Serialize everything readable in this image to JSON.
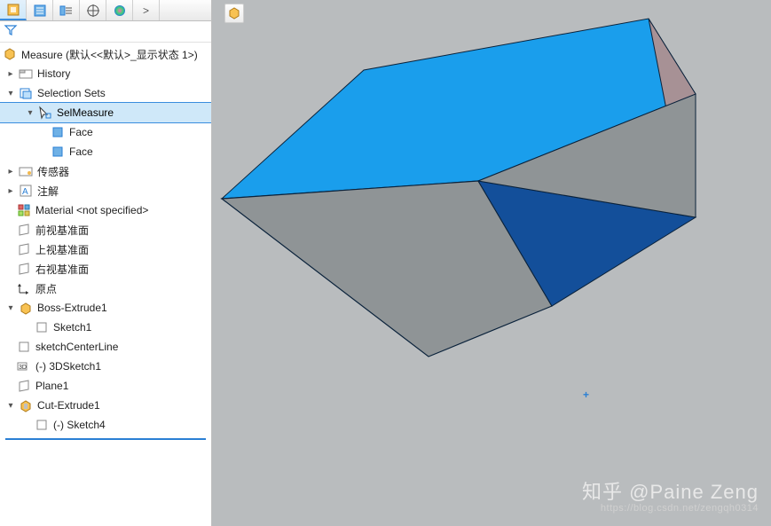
{
  "tabs": {
    "feature": "feature-manager-icon",
    "property": "property-manager-icon",
    "config": "configuration-manager-icon",
    "dim": "dimxpert-icon",
    "display": "display-manager-icon",
    "more": ">"
  },
  "tree": {
    "root": {
      "label": "Measure  (默认<<默认>_显示状态 1>)"
    },
    "history": {
      "label": "History"
    },
    "selsets": {
      "label": "Selection Sets"
    },
    "selmeasure": {
      "label": "SelMeasure"
    },
    "face1": {
      "label": "Face"
    },
    "face2": {
      "label": "Face"
    },
    "sensors": {
      "label": "传感器"
    },
    "annotations": {
      "label": "注解"
    },
    "material": {
      "label": "Material <not specified>"
    },
    "front": {
      "label": "前视基准面"
    },
    "top": {
      "label": "上视基准面"
    },
    "right": {
      "label": "右视基准面"
    },
    "origin": {
      "label": "原点"
    },
    "boss": {
      "label": "Boss-Extrude1"
    },
    "sketch1": {
      "label": "Sketch1"
    },
    "centerline": {
      "label": "sketchCenterLine"
    },
    "sketch3d": {
      "label": "(-) 3DSketch1"
    },
    "plane1": {
      "label": "Plane1"
    },
    "cut": {
      "label": "Cut-Extrude1"
    },
    "sketch4": {
      "label": "(-) Sketch4"
    }
  },
  "watermark": {
    "main": "知乎 @Paine Zeng",
    "sub": "https://blog.csdn.net/zengqh0314"
  }
}
